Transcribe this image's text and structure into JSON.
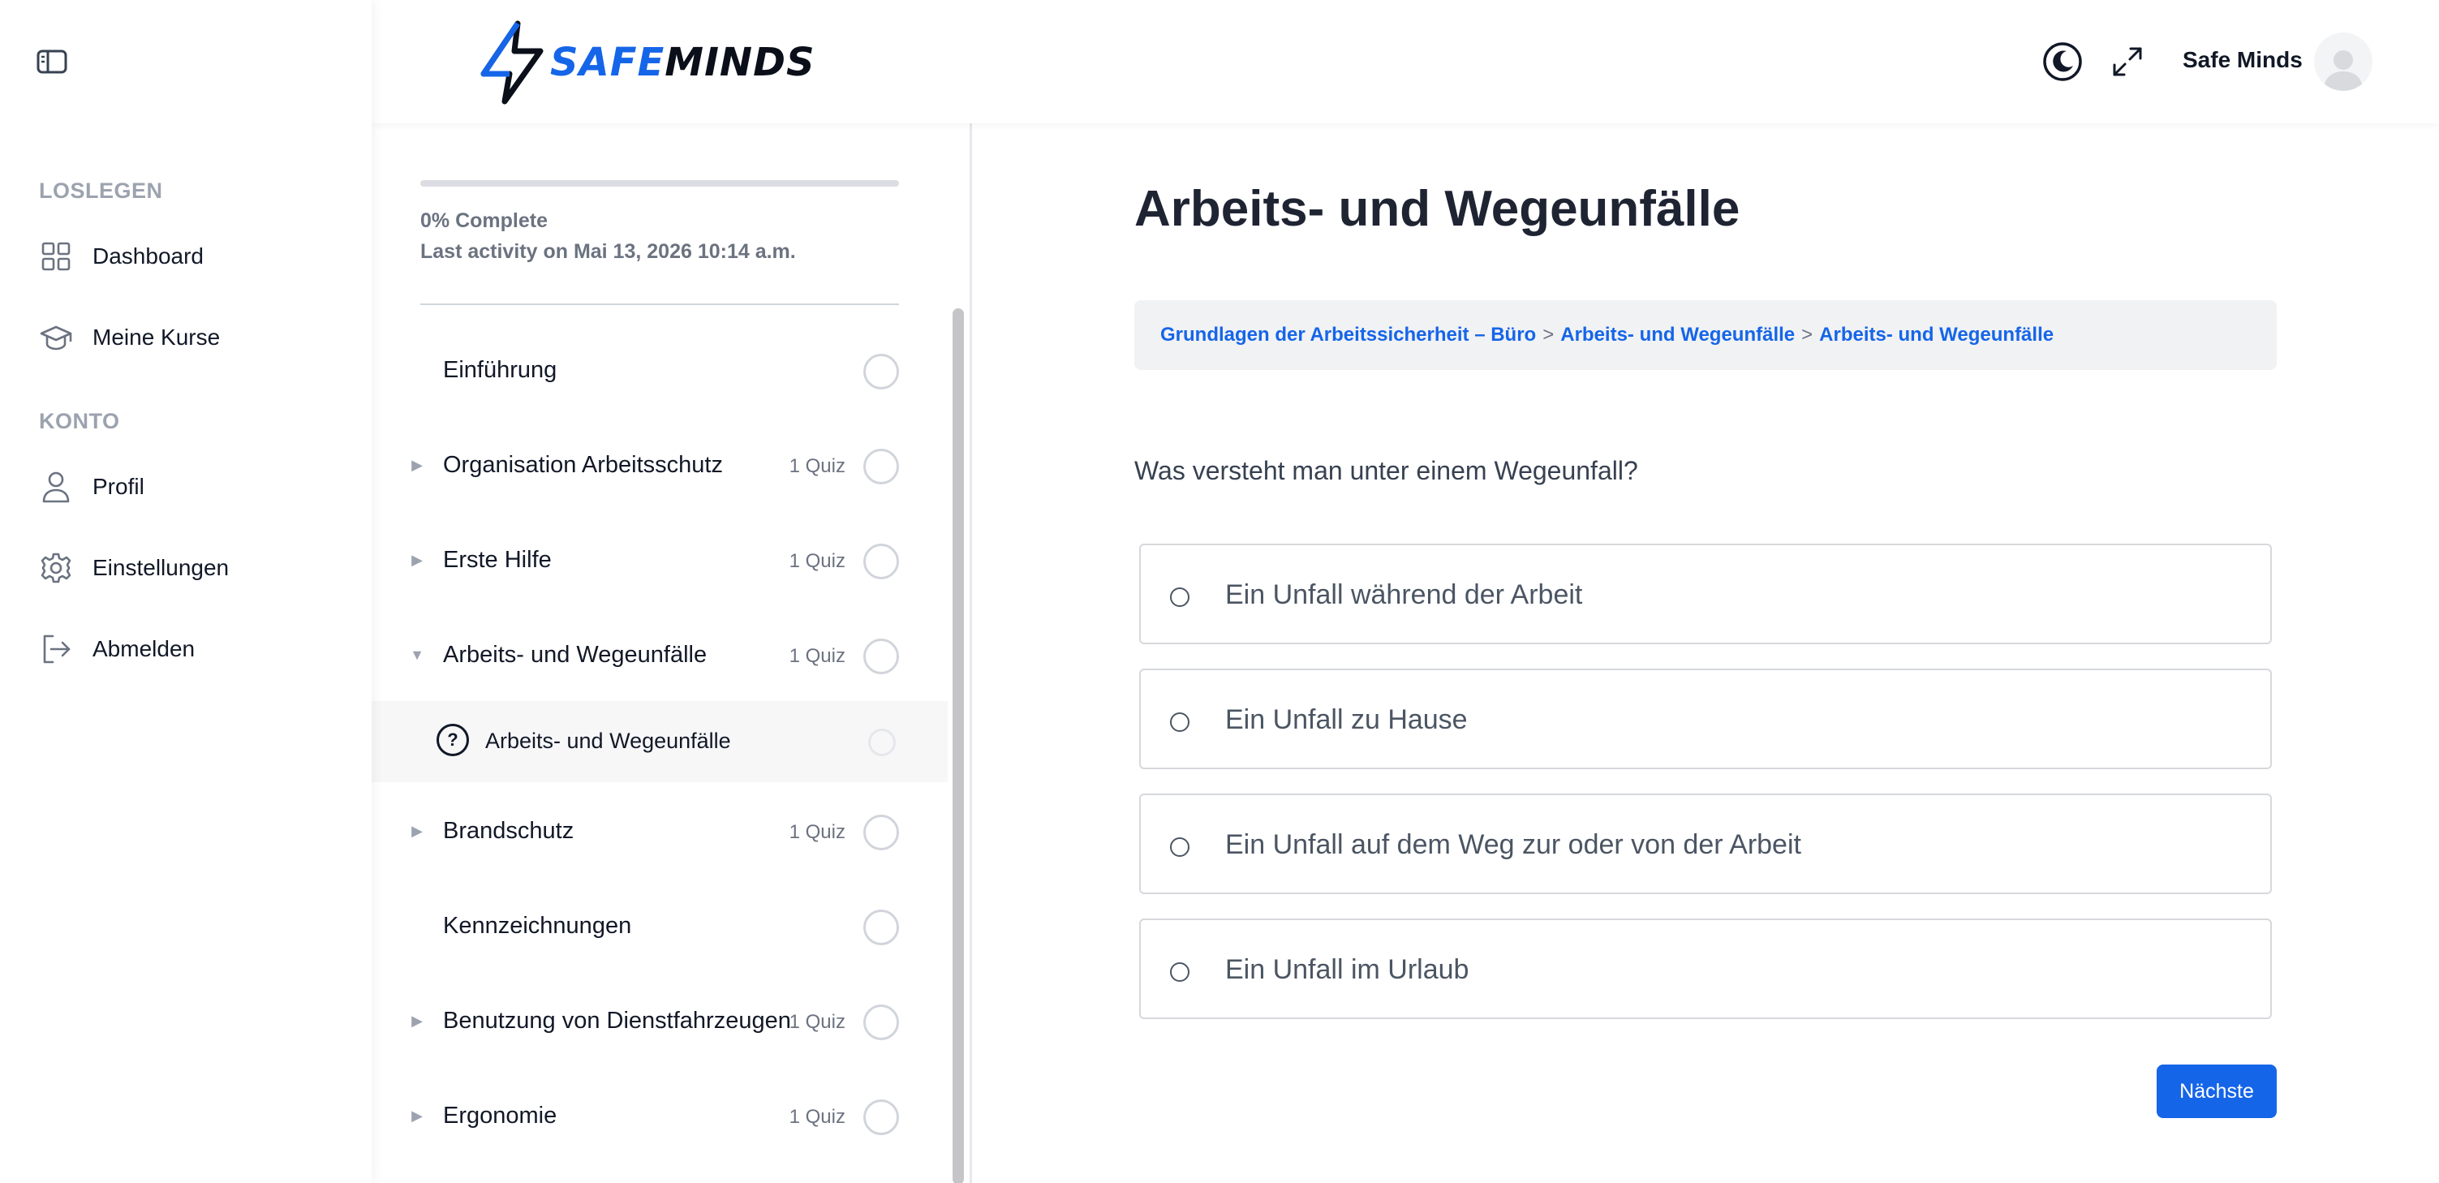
{
  "header": {
    "logo": {
      "part1": "SAFE",
      "part2": "MINDS"
    },
    "user_name": "Safe Minds",
    "icons": {
      "theme": "moon-icon",
      "fullscreen": "expand-icon",
      "avatar": "user-avatar-icon"
    }
  },
  "nav": {
    "toggle_icon": "sidebar-toggle-icon",
    "sections": [
      {
        "title": "LOSLEGEN",
        "items": [
          {
            "label": "Dashboard",
            "icon": "grid-icon"
          },
          {
            "label": "Meine Kurse",
            "icon": "graduation-cap-icon"
          }
        ]
      },
      {
        "title": "KONTO",
        "items": [
          {
            "label": "Profil",
            "icon": "user-icon"
          },
          {
            "label": "Einstellungen",
            "icon": "gear-icon"
          },
          {
            "label": "Abmelden",
            "icon": "logout-icon"
          }
        ]
      }
    ]
  },
  "outline": {
    "progress_percent": 0,
    "progress_label": "0% Complete",
    "last_activity": "Last activity on Mai 13, 2026 10:14 a.m.",
    "items": [
      {
        "title": "Einführung",
        "count": ""
      },
      {
        "title": "Organisation Arbeitsschutz",
        "count": "1 Quiz"
      },
      {
        "title": "Erste Hilfe",
        "count": "1 Quiz"
      },
      {
        "title": "Arbeits- und Wegeunfälle",
        "count": "1 Quiz"
      },
      {
        "title": "Brandschutz",
        "count": "1 Quiz"
      },
      {
        "title": "Kennzeichnungen",
        "count": ""
      },
      {
        "title": "Benutzung von Dienstfahrzeugen",
        "count": "1 Quiz"
      },
      {
        "title": "Ergonomie",
        "count": "1 Quiz"
      }
    ],
    "active_sub": {
      "title": "Arbeits- und Wegeunfälle",
      "icon_glyph": "?"
    }
  },
  "main": {
    "title": "Arbeits- und Wegeunfälle",
    "breadcrumb": [
      "Grundlagen der Arbeitssicherheit – Büro",
      "Arbeits- und Wegeunfälle",
      "Arbeits- und Wegeunfälle"
    ],
    "breadcrumb_sep": ">",
    "question": "Was versteht man unter einem Wegeunfall?",
    "answers": [
      "Ein Unfall während der Arbeit",
      "Ein Unfall zu Hause",
      "Ein Unfall auf dem Weg zur oder von der Arbeit",
      "Ein Unfall im Urlaub"
    ],
    "next_label": "Nächste"
  },
  "colors": {
    "accent": "#1565e8",
    "text_dark": "#1f2433",
    "muted": "#6b7280"
  }
}
